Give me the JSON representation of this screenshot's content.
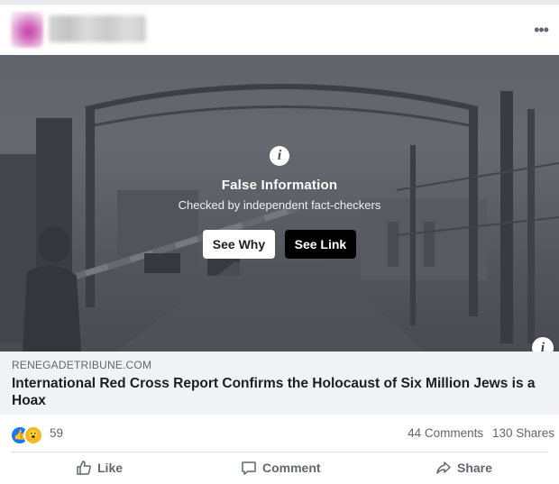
{
  "post": {
    "menu_glyph": "•••"
  },
  "factcheck": {
    "info_glyph": "i",
    "title": "False Information",
    "subtitle": "Checked by independent fact-checkers",
    "see_why_label": "See Why",
    "see_link_label": "See Link",
    "corner_info_glyph": "i"
  },
  "link": {
    "domain": "RENEGADETRIBUNE.COM",
    "headline": "International Red Cross Report Confirms the Holocaust of Six Million Jews is a Hoax"
  },
  "stats": {
    "reaction_count": "59",
    "comments": "44 Comments",
    "shares": "130 Shares",
    "reactions": [
      "like-icon",
      "wow-icon"
    ]
  },
  "actions": {
    "like_label": "Like",
    "comment_label": "Comment",
    "share_label": "Share"
  },
  "colors": {
    "accent": "#1877f2",
    "wow": "#f7b928",
    "link_bg": "#f0f2f5",
    "text_secondary": "#606770"
  }
}
